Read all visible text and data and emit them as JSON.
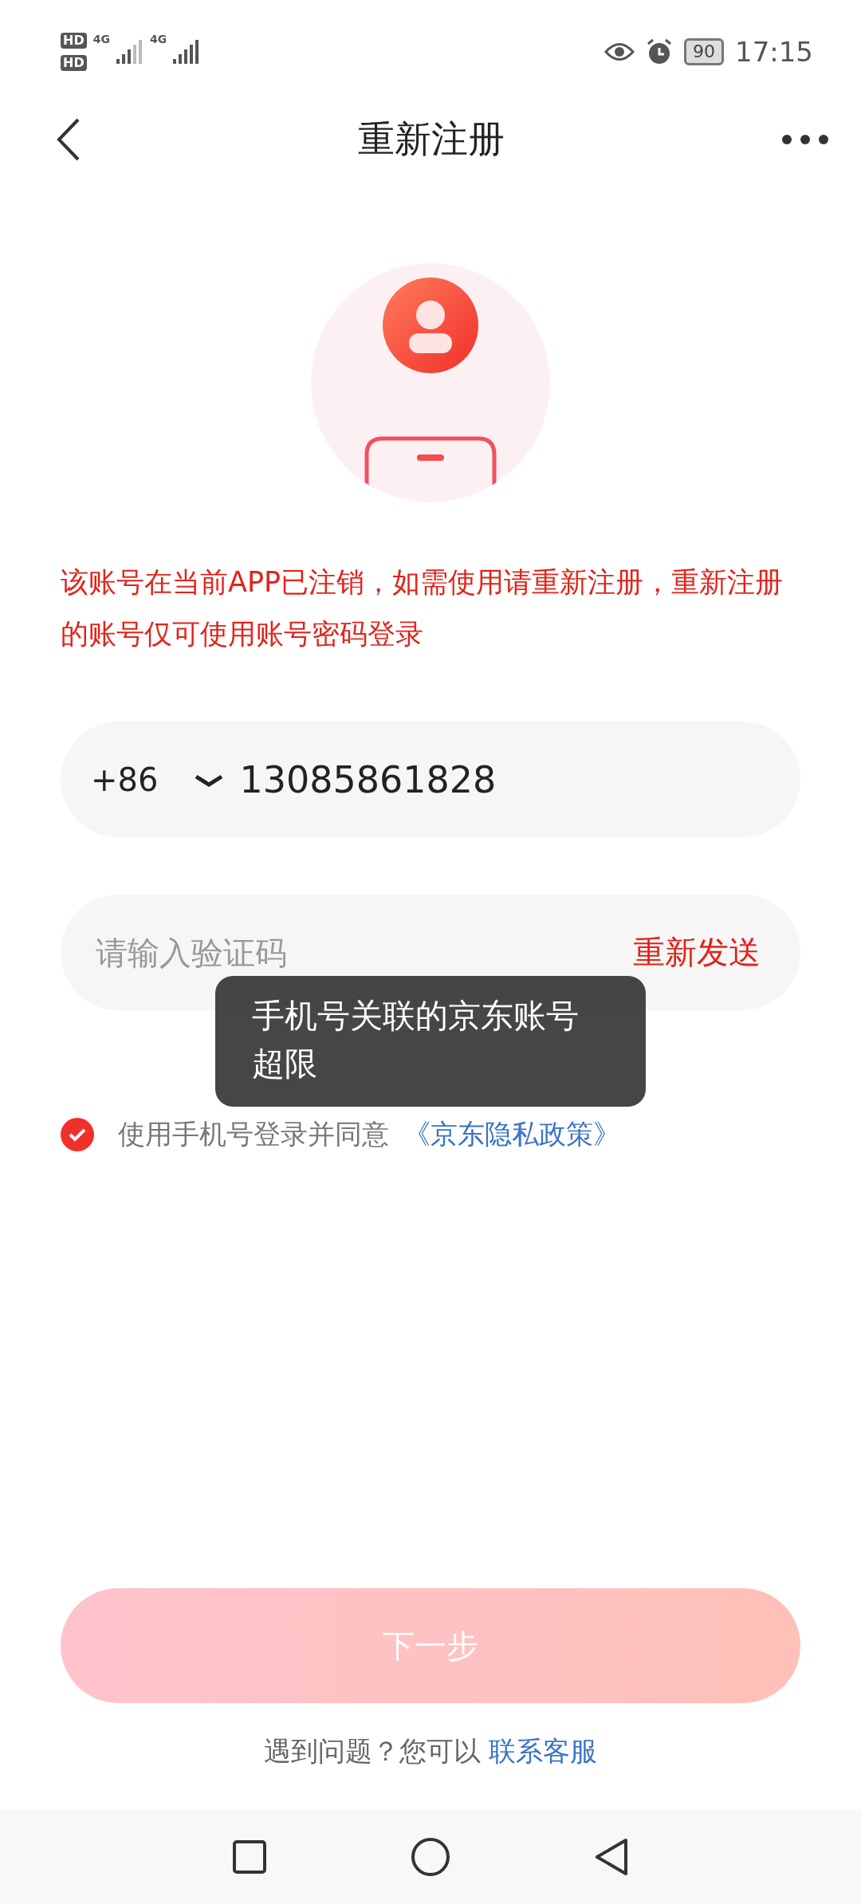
{
  "status_bar": {
    "sim_1": "HD",
    "sim_2": "HD",
    "net_1": "4G",
    "net_2": "4G",
    "battery": "90",
    "time": "17:15"
  },
  "nav": {
    "title": "重新注册"
  },
  "notice": "该账号在当前APP已注销，如需使用请重新注册，重新注册的账号仅可使用账号密码登录",
  "phone_field": {
    "country_code": "+86",
    "value": "13085861828"
  },
  "code_field": {
    "placeholder": "请输入验证码",
    "resend": "重新发送"
  },
  "agreement": {
    "checked": true,
    "text": "使用手机号登录并同意",
    "link": "《京东隐私政策》"
  },
  "toast": "手机号关联的京东账号超限",
  "next_button": {
    "label": "下一步",
    "disabled": true
  },
  "help": {
    "text": "遇到问题？您可以",
    "link": "联系客服"
  }
}
